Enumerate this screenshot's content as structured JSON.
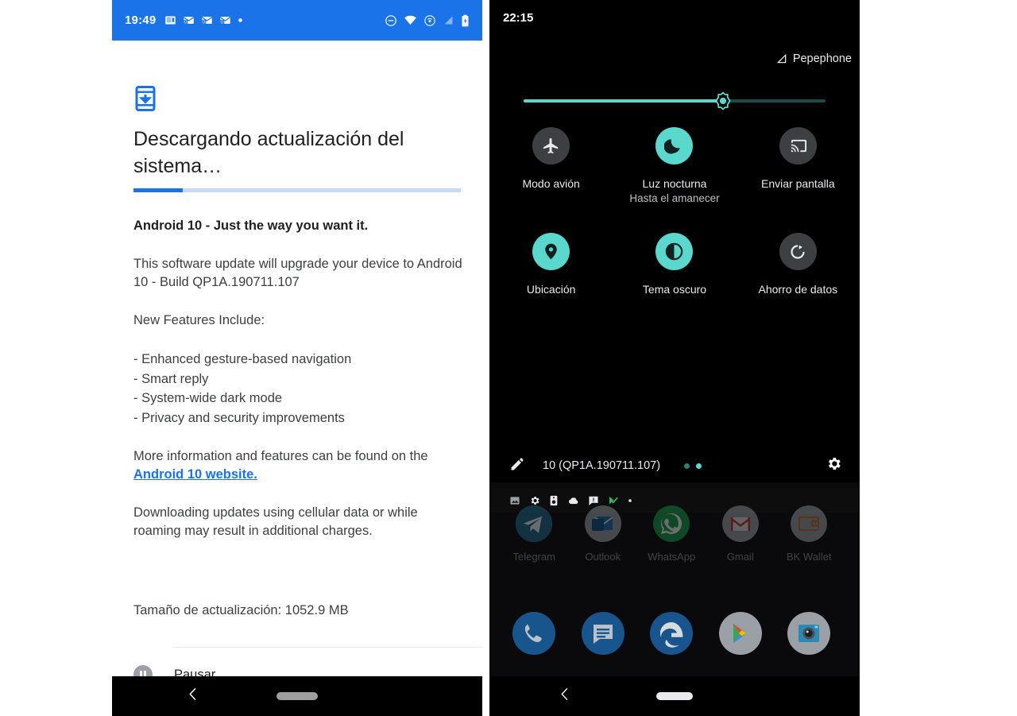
{
  "left_phone": {
    "status_bar": {
      "time": "19:49",
      "left_icons": [
        "news-icon",
        "outlook-mail-icon",
        "outlook-mail-icon",
        "outlook-mail-icon",
        "more-dot-icon"
      ],
      "right_icons": [
        "do-not-disturb-icon",
        "wifi-icon",
        "hotspot-icon",
        "cell-signal-icon",
        "battery-charging-icon"
      ],
      "accent_color": "#1a73e8"
    },
    "header_icon": "system-update-download-icon",
    "title": "Descargando actualización del sistema…",
    "progress": {
      "percent": 15,
      "fill_color": "#1a73e8",
      "track_color": "#c6dafc"
    },
    "body": {
      "headline": "Android 10 - Just the way you want it.",
      "paragraph_1": "This software update will upgrade your device to Android 10 - Build QP1A.190711.107",
      "paragraph_2": "New Features Include:",
      "features": [
        "- Enhanced gesture-based navigation",
        "- Smart reply",
        "- System-wide dark mode",
        "- Privacy and security improvements"
      ],
      "paragraph_3_prefix": "More information and features can be found on the ",
      "link_text": "Android 10 website.",
      "paragraph_4": "Downloading updates using cellular data or while roaming may result in additional charges."
    },
    "update_size": "Tamaño de actualización: 1052.9 MB",
    "pause_button": "Pausar",
    "nav_bar": {
      "back": "back-icon",
      "home": "home-pill"
    }
  },
  "right_phone": {
    "status_bar": {
      "time": "22:15"
    },
    "carrier": {
      "label": "Pepephone",
      "icon": "cell-signal-icon"
    },
    "brightness": {
      "percent": 66,
      "handle_icon": "brightness-sun-icon",
      "accent": "#5ad8cd"
    },
    "tiles": [
      {
        "label": "Modo avión",
        "sub": "",
        "icon": "airplane-icon",
        "state": "off"
      },
      {
        "label": "Luz nocturna",
        "sub": "Hasta el amanecer",
        "icon": "moon-icon",
        "state": "on"
      },
      {
        "label": "Enviar pantalla",
        "sub": "",
        "icon": "cast-icon",
        "state": "off"
      },
      {
        "label": "Ubicación",
        "sub": "",
        "icon": "location-pin-icon",
        "state": "on"
      },
      {
        "label": "Tema oscuro",
        "sub": "",
        "icon": "contrast-half-circle-icon",
        "state": "on"
      },
      {
        "label": "Ahorro de datos",
        "sub": "",
        "icon": "data-saver-icon",
        "state": "off"
      }
    ],
    "footer": {
      "edit_icon": "pencil-edit-icon",
      "build": "10 (QP1A.190711.107)",
      "page_dots": 2,
      "active_dot": 2,
      "settings_icon": "gear-icon"
    },
    "notification_icons": [
      "image-icon",
      "settings-gear-icon",
      "speaker-icon",
      "cloud-icon",
      "message-alert-icon",
      "play-protect-icon",
      "more-dot-icon"
    ],
    "app_row": [
      {
        "name": "Telegram",
        "icon": "telegram-icon"
      },
      {
        "name": "Outlook",
        "icon": "outlook-icon"
      },
      {
        "name": "WhatsApp",
        "icon": "whatsapp-icon"
      },
      {
        "name": "Gmail",
        "icon": "gmail-icon"
      },
      {
        "name": "BK Wallet",
        "icon": "bk-wallet-icon"
      }
    ],
    "dock": [
      {
        "name": "Phone",
        "icon": "phone-icon"
      },
      {
        "name": "Messages",
        "icon": "messages-icon"
      },
      {
        "name": "Edge",
        "icon": "edge-browser-icon"
      },
      {
        "name": "Play Store",
        "icon": "play-store-icon"
      },
      {
        "name": "Camera",
        "icon": "camera-icon"
      }
    ],
    "nav_bar": {
      "back": "back-icon",
      "home": "home-pill"
    }
  }
}
